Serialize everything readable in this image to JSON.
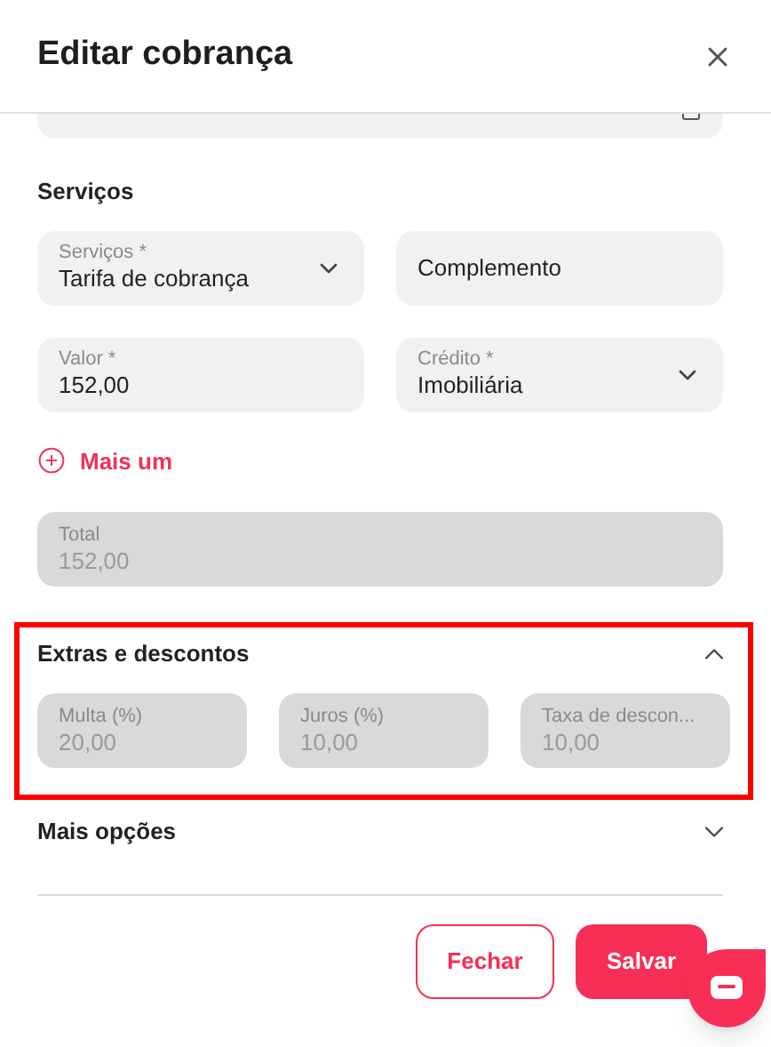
{
  "window": {
    "title": "Editar cobrança"
  },
  "services": {
    "title": "Serviços",
    "fields": [
      {
        "kind": "select",
        "label": "Serviços *",
        "value": "Tarifa de cobrança"
      },
      {
        "kind": "text",
        "placeholder": "Complemento"
      },
      {
        "kind": "text",
        "label": "Valor *",
        "value": "152,00"
      },
      {
        "kind": "select",
        "label": "Crédito *",
        "value": "Imobiliária"
      }
    ],
    "add_link": "Mais um",
    "total": {
      "label": "Total",
      "value": "152,00",
      "disabled": true
    }
  },
  "sections": [
    {
      "title": "Extras e descontos",
      "expanded": true,
      "highlighted": true,
      "fields": [
        {
          "label": "Multa (%)",
          "value": "20,00",
          "disabled": true
        },
        {
          "label": "Juros (%)",
          "value": "10,00",
          "disabled": true
        },
        {
          "label": "Taxa de descon...",
          "value": "10,00",
          "disabled": true
        }
      ]
    },
    {
      "title": "Mais opções",
      "expanded": false,
      "highlighted": false
    }
  ],
  "buttons": [
    {
      "kind": "secondary",
      "label": "Fechar"
    },
    {
      "kind": "primary",
      "label": "Salvar"
    }
  ]
}
